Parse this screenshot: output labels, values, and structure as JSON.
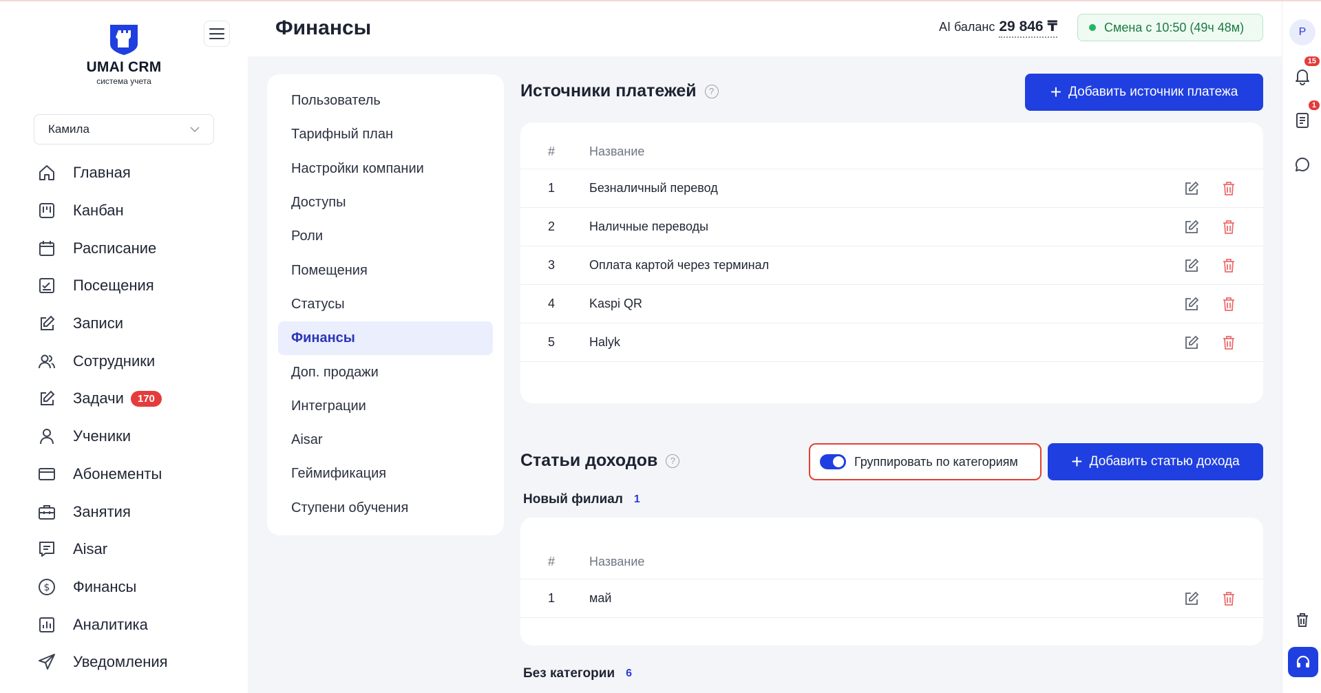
{
  "app": {
    "name": "UMAI CRM",
    "subtitle": "система учета"
  },
  "user_select": {
    "value": "Камила"
  },
  "nav": [
    {
      "label": "Главная",
      "icon": "home-icon"
    },
    {
      "label": "Канбан",
      "icon": "kanban-icon"
    },
    {
      "label": "Расписание",
      "icon": "calendar-icon"
    },
    {
      "label": "Посещения",
      "icon": "attendance-icon"
    },
    {
      "label": "Записи",
      "icon": "edit-icon"
    },
    {
      "label": "Сотрудники",
      "icon": "staff-icon"
    },
    {
      "label": "Задачи",
      "icon": "tasks-icon",
      "badge": "170"
    },
    {
      "label": "Ученики",
      "icon": "student-icon"
    },
    {
      "label": "Абонементы",
      "icon": "card-icon"
    },
    {
      "label": "Занятия",
      "icon": "briefcase-icon"
    },
    {
      "label": "Aisar",
      "icon": "chat-doc-icon"
    },
    {
      "label": "Финансы",
      "icon": "dollar-icon"
    },
    {
      "label": "Аналитика",
      "icon": "analytics-icon"
    },
    {
      "label": "Уведомления",
      "icon": "send-icon"
    }
  ],
  "header": {
    "title": "Финансы",
    "ai_label": "AI баланс",
    "ai_value": "29 846 ₸",
    "shift": "Смена с 10:50 (49ч 48м)"
  },
  "rail": {
    "avatar": "P",
    "notifications_badge": "15",
    "docs_badge": "1"
  },
  "settings_menu": [
    "Пользователь",
    "Тарифный план",
    "Настройки компании",
    "Доступы",
    "Роли",
    "Помещения",
    "Статусы",
    "Финансы",
    "Доп. продажи",
    "Интеграции",
    "Aisar",
    "Геймификация",
    "Ступени обучения"
  ],
  "payment_sources": {
    "title": "Источники платежей",
    "add_label": "Добавить источник платежа",
    "col_num": "#",
    "col_name": "Название",
    "rows": [
      {
        "n": "1",
        "name": "Безналичный перевод"
      },
      {
        "n": "2",
        "name": "Наличные переводы"
      },
      {
        "n": "3",
        "name": "Оплата картой через терминал"
      },
      {
        "n": "4",
        "name": "Kaspi QR"
      },
      {
        "n": "5",
        "name": "Halyk"
      }
    ]
  },
  "income": {
    "title": "Статьи доходов",
    "toggle_label": "Группировать по категориям",
    "toggle_on": true,
    "add_label": "Добавить статью дохода",
    "group1": {
      "title": "Новый филиал",
      "count": "1",
      "col_num": "#",
      "col_name": "Название",
      "rows": [
        {
          "n": "1",
          "name": "май"
        }
      ]
    },
    "group2": {
      "title": "Без категории",
      "count": "6"
    }
  },
  "colors": {
    "accent": "#1f3fe0",
    "danger": "#e53b3b",
    "success": "#24b565"
  }
}
